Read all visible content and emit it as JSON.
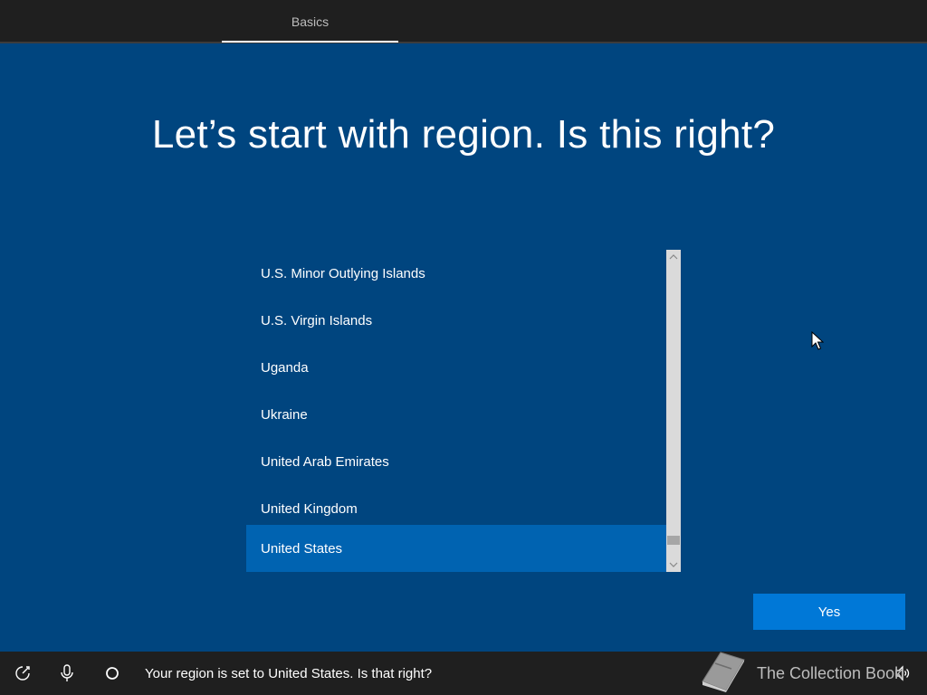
{
  "header": {
    "tab_label": "Basics"
  },
  "main": {
    "title": "Let’s start with region. Is this right?",
    "regions": [
      "U.S. Minor Outlying Islands",
      "U.S. Virgin Islands",
      "Uganda",
      "Ukraine",
      "United Arab Emirates",
      "United Kingdom",
      "United States"
    ],
    "selected_region": "United States",
    "yes_label": "Yes"
  },
  "footer": {
    "ease_of_access_icon": "ease-of-access-icon",
    "microphone_icon": "microphone-icon",
    "cortana_icon": "cortana-circle-icon",
    "narration": "Your region is set to United States. Is that right?",
    "volume_icon": "volume-icon"
  },
  "watermark": {
    "text": "The Collection Book",
    "icon": "book-icon"
  },
  "colors": {
    "background": "#00457f",
    "selected": "#0063b1",
    "button": "#0078d7",
    "bar": "#1f1f1f"
  }
}
